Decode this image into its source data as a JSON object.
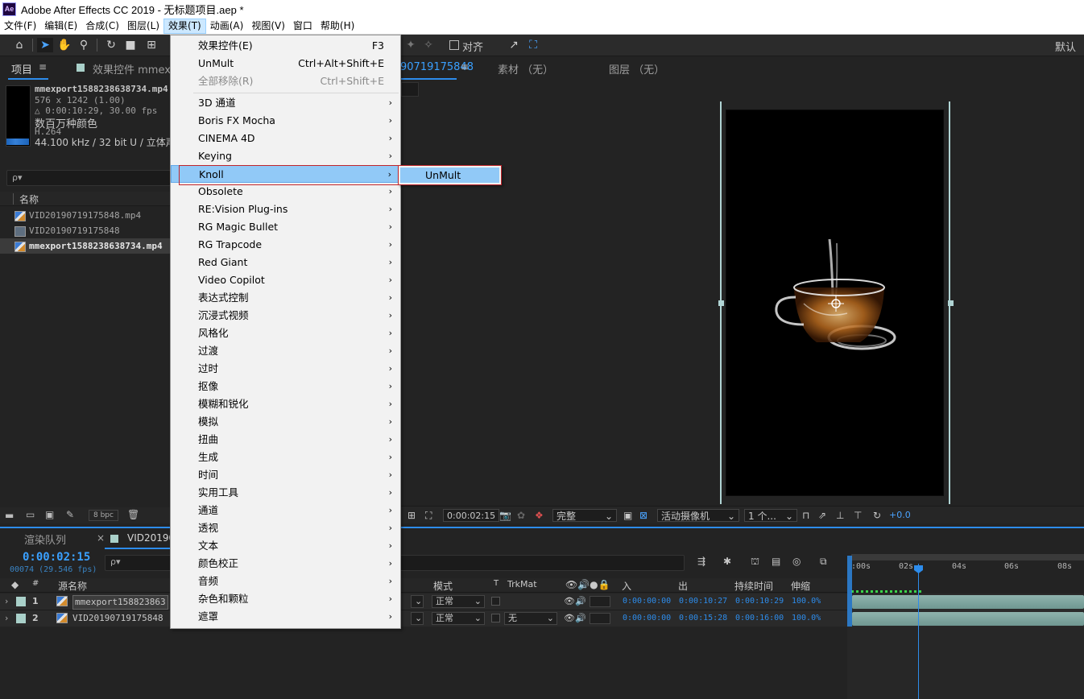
{
  "window": {
    "title": "Adobe After Effects CC 2019 - 无标题项目.aep *",
    "logo": "Ae"
  },
  "menubar": {
    "items": [
      "文件(F)",
      "编辑(E)",
      "合成(C)",
      "图层(L)",
      "效果(T)",
      "动画(A)",
      "视图(V)",
      "窗口",
      "帮助(H)"
    ],
    "active": "效果(T)"
  },
  "toolbar": {
    "align_label": "对齐",
    "workspace": "默认"
  },
  "project_panel": {
    "tab_label": "项目",
    "effects_tab_label": "效果控件 mmexp",
    "selected_info": {
      "name": "mmexport1588238638734.mp4",
      "dimensions": "576 x 1242 (1.00)",
      "duration": "△ 0:00:10:29, 30.00 fps",
      "colors": "数百万种颜色",
      "codec": "H.264",
      "audio": "44.100 kHz / 32 bit U / 立体声"
    },
    "search_icon": "ρ▾",
    "column_name": "名称",
    "files": [
      {
        "name": "VID20190719175848.mp4",
        "type": "footage"
      },
      {
        "name": "VID20190719175848",
        "type": "comp"
      },
      {
        "name": "mmexport1588238638734.mp4",
        "type": "footage",
        "selected": true
      }
    ],
    "bpc": "8 bpc"
  },
  "viewer_panel": {
    "comp_tab_suffix": "90719175848",
    "footage_tab": "素材 （无）",
    "layer_tab": "图层 （无）",
    "timecode": "0:00:02:15",
    "resolution": "完整",
    "camera": "活动摄像机",
    "views": "1 个...",
    "exposure": "+0.0"
  },
  "timeline_panel": {
    "render_queue_tab": "渲染队列",
    "comp_tab": "VID201907",
    "timecode": "0:00:02:15",
    "frames": "00074 (29.546 fps)",
    "columns": {
      "num": "#",
      "source": "源名称",
      "mode": "模式",
      "t": "T",
      "trkmat": "TrkMat",
      "in": "入",
      "out": "出",
      "duration": "持续时间",
      "stretch": "伸缩"
    },
    "ruler_ticks": [
      ":00s",
      "02s",
      "04s",
      "06s",
      "08s"
    ],
    "layers": [
      {
        "num": "1",
        "name": "mmexport158823863",
        "mode": "正常",
        "trkmat": "",
        "in": "0:00:00:00",
        "out": "0:00:10:27",
        "duration": "0:00:10:29",
        "stretch": "100.0%"
      },
      {
        "num": "2",
        "name": "VID20190719175848",
        "mode": "正常",
        "trkmat": "无",
        "in": "0:00:00:00",
        "out": "0:00:15:28",
        "duration": "0:00:16:00",
        "stretch": "100.0%"
      }
    ]
  },
  "effect_menu": {
    "top_items": [
      {
        "label": "效果控件(E)",
        "shortcut": "F3"
      },
      {
        "label": "UnMult",
        "shortcut": "Ctrl+Alt+Shift+E"
      },
      {
        "label": "全部移除(R)",
        "shortcut": "Ctrl+Shift+E",
        "disabled": true
      }
    ],
    "categories": [
      "3D 通道",
      "Boris FX Mocha",
      "CINEMA 4D",
      "Keying",
      "Knoll",
      "Obsolete",
      "RE:Vision Plug-ins",
      "RG Magic Bullet",
      "RG Trapcode",
      "Red Giant",
      "Video Copilot",
      "表达式控制",
      "沉浸式视频",
      "风格化",
      "过渡",
      "过时",
      "抠像",
      "模糊和锐化",
      "模拟",
      "扭曲",
      "生成",
      "时间",
      "实用工具",
      "通道",
      "透视",
      "文本",
      "颜色校正",
      "音频",
      "杂色和颗粒",
      "遮罩"
    ],
    "highlighted": "Knoll",
    "arrow": "›",
    "submenu": {
      "items": [
        "UnMult"
      ]
    }
  }
}
